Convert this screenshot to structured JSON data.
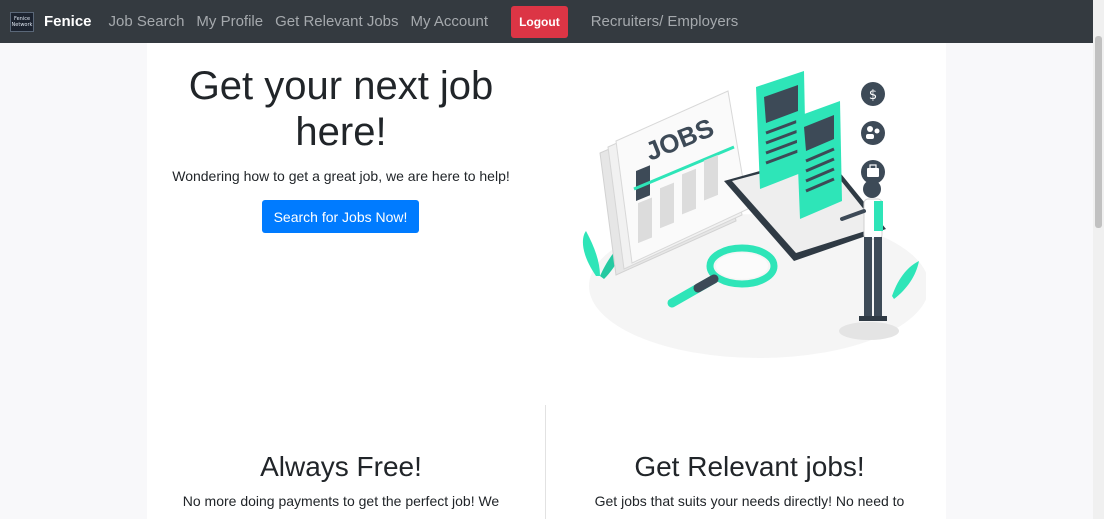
{
  "navbar": {
    "logo_line1": "Fenice",
    "logo_line2": "Network",
    "brand": "Fenice",
    "links": [
      "Job Search",
      "My Profile",
      "Get Relevant Jobs",
      "My Account"
    ],
    "logout_label": "Logout",
    "recruiters_link": "Recruiters/ Employers"
  },
  "hero": {
    "title": "Get your next job here!",
    "subtitle": "Wondering how to get a great job, we are here to help!",
    "cta_label": "Search for Jobs Now!"
  },
  "illustration": {
    "sign_text": "JOBS",
    "icons": [
      "dollar-icon",
      "people-icon",
      "briefcase-icon"
    ]
  },
  "features": [
    {
      "title": "Always Free!",
      "text": "No more doing payments to get the perfect job! We"
    },
    {
      "title": "Get Relevant jobs!",
      "text": "Get jobs that suits your needs directly! No need to"
    }
  ],
  "colors": {
    "navbar_bg": "#343a40",
    "logout_red": "#dc3545",
    "primary_blue": "#007bff",
    "accent_teal": "#2ee5b8"
  }
}
